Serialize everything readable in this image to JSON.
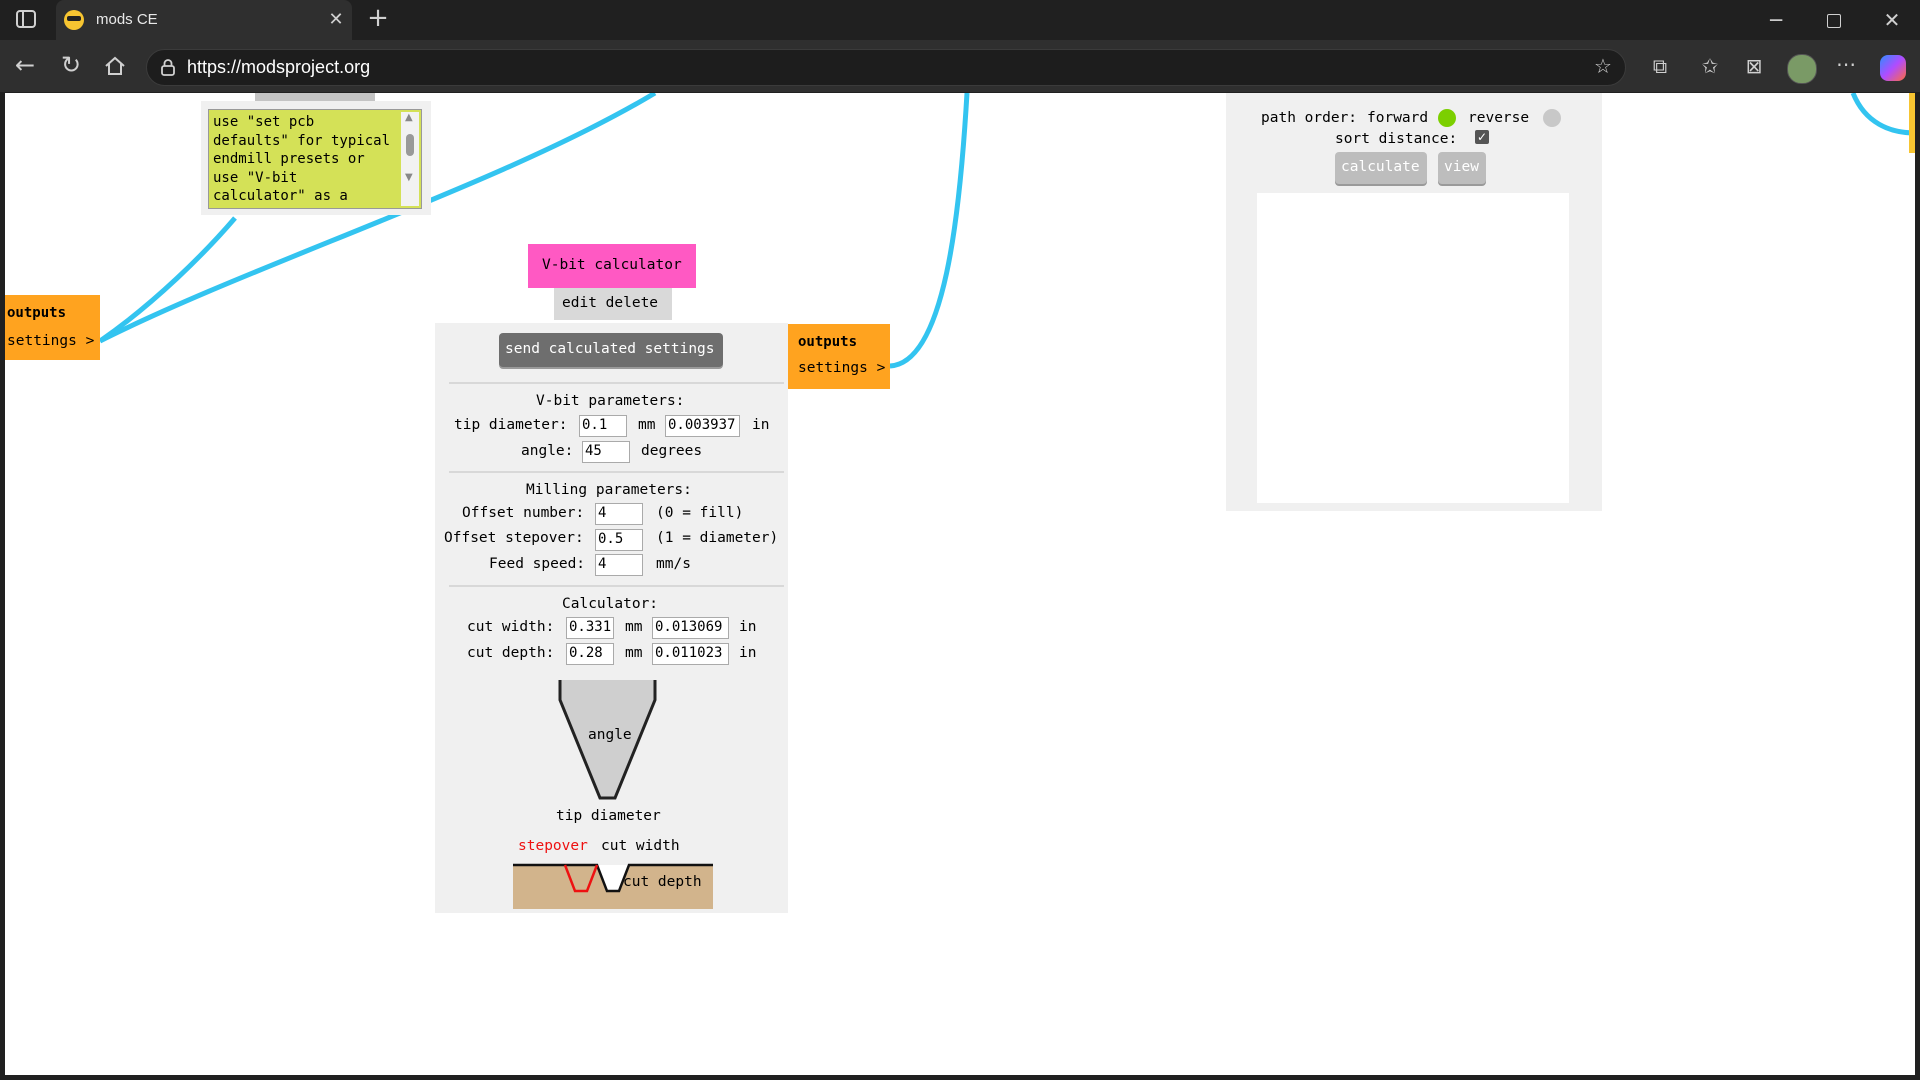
{
  "browser": {
    "tab_title": "mods CE",
    "url": "https://modsproject.org"
  },
  "note": {
    "text": "use \"set pcb defaults\" for typical endmill presets or use \"V-bit calculator\" as a"
  },
  "left_outputs": {
    "title": "outputs",
    "item": "settings >"
  },
  "vbit_module": {
    "title": "V-bit calculator",
    "edit_delete": "edit delete",
    "send_button": "send calculated settings",
    "vbit_heading": "V-bit parameters:",
    "tip_label": "tip diameter:",
    "tip_mm": "0.1",
    "mm_unit": "mm",
    "tip_in": "0.003937",
    "in_unit": "in",
    "angle_label": "angle:",
    "angle_value": "45",
    "degrees_unit": "degrees",
    "milling_heading": "Milling parameters:",
    "offset_number_label": "Offset number:",
    "offset_number_value": "4",
    "offset_number_hint": "(0 = fill)",
    "offset_stepover_label": "Offset stepover:",
    "offset_stepover_value": "0.5",
    "offset_stepover_hint": "(1 = diameter)",
    "feed_label": "Feed speed:",
    "feed_value": "4",
    "feed_unit": "mm/s",
    "calc_heading": "Calculator:",
    "cut_width_label": "cut width:",
    "cut_width_mm": "0.331",
    "cut_width_in": "0.013069",
    "cut_depth_label": "cut depth:",
    "cut_depth_mm": "0.28",
    "cut_depth_in": "0.011023",
    "diagram_angle": "angle",
    "diagram_tip": "tip diameter",
    "diagram_stepover": "stepover",
    "diagram_cut_width": "cut width",
    "diagram_cut_depth": "cut depth"
  },
  "right_outputs": {
    "title": "outputs",
    "item": "settings >"
  },
  "path_module": {
    "path_order_label": "path order:",
    "forward_label": "forward",
    "reverse_label": "reverse",
    "sort_distance_label": "sort distance:",
    "sort_distance_checked": true,
    "calculate_button": "calculate",
    "view_button": "view"
  },
  "colors": {
    "wire": "#33c4f0",
    "outputs_bg": "#ffa31f",
    "title_pink": "#ff59c3",
    "note_bg": "#d4e157",
    "forward_dot": "#7ccf00",
    "reverse_dot": "#c8c8c8"
  }
}
